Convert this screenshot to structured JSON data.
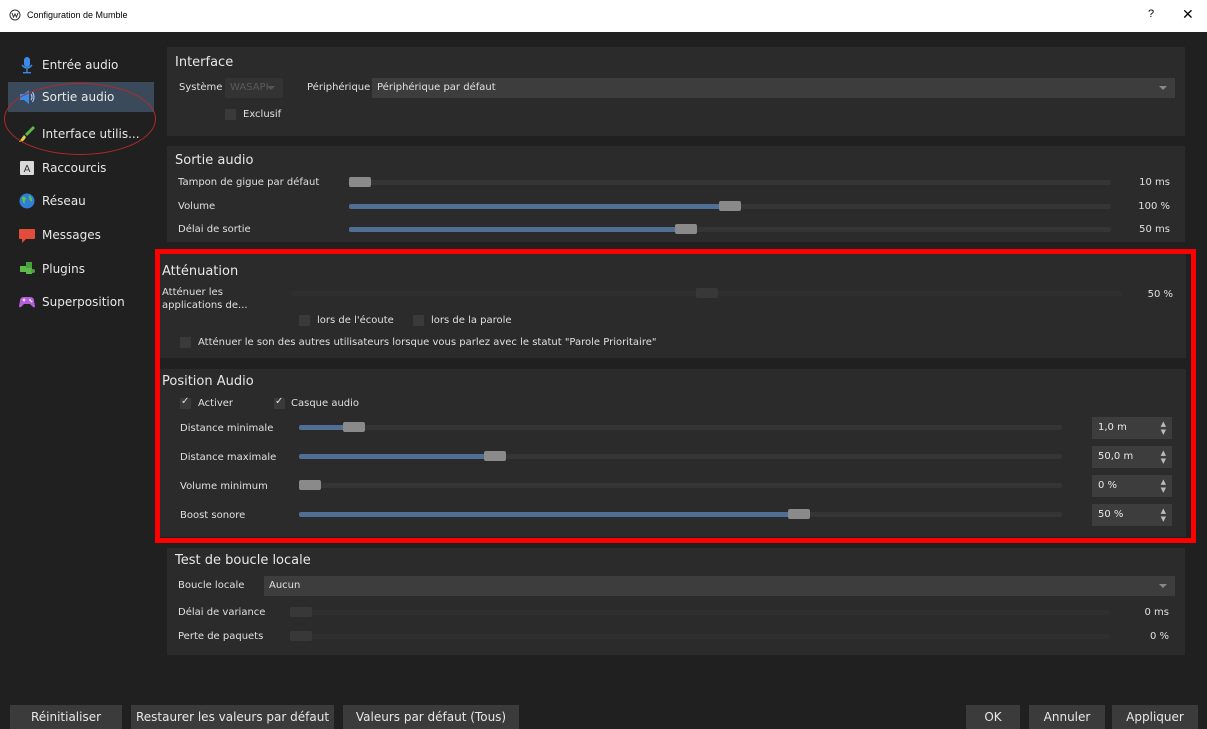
{
  "window": {
    "title": "Configuration de Mumble",
    "help": "?",
    "close": "✕"
  },
  "sidebar": {
    "items": [
      {
        "label": "Entrée audio",
        "icon": "microphone-icon"
      },
      {
        "label": "Sortie audio",
        "icon": "speaker-icon"
      },
      {
        "label": "Interface utilis...",
        "icon": "brush-icon"
      },
      {
        "label": "Raccourcis",
        "icon": "keyboard-key-icon"
      },
      {
        "label": "Réseau",
        "icon": "globe-icon"
      },
      {
        "label": "Messages",
        "icon": "chat-bubble-icon"
      },
      {
        "label": "Plugins",
        "icon": "puzzle-icon"
      },
      {
        "label": "Superposition",
        "icon": "gamepad-icon"
      }
    ],
    "active_index": 1
  },
  "interface": {
    "title": "Interface",
    "system_label": "Système",
    "system_value": "WASAPI",
    "device_label": "Périphérique",
    "device_value": "Périphérique par défaut",
    "exclusive_label": "Exclusif",
    "exclusive_checked": false
  },
  "audio_output": {
    "title": "Sortie audio",
    "jitter_label": "Tampon de gigue par défaut",
    "jitter_value": "10 ms",
    "jitter_fraction": 0.0,
    "volume_label": "Volume",
    "volume_value": "100 %",
    "volume_fraction": 0.5,
    "delay_label": "Délai de sortie",
    "delay_value": "50 ms",
    "delay_fraction": 0.44
  },
  "attenuation": {
    "title": "Atténuation",
    "apps_label_1": "Atténuer les",
    "apps_label_2": "applications de...",
    "apps_value": "50 %",
    "apps_fraction": 0.5,
    "listening_label": "lors de l'écoute",
    "speaking_label": "lors de la parole",
    "priority_label": "Atténuer le son des autres utilisateurs lorsque vous parlez avec le statut \"Parole Prioritaire\""
  },
  "positional_audio": {
    "title": "Position Audio",
    "enable_label": "Activer",
    "enable_checked": true,
    "headphones_label": "Casque audio",
    "headphones_checked": true,
    "min_distance_label": "Distance minimale",
    "min_distance_value": "1,0 m",
    "min_distance_fraction": 0.06,
    "max_distance_label": "Distance maximale",
    "max_distance_value": "50,0 m",
    "max_distance_fraction": 0.25,
    "min_volume_label": "Volume minimum",
    "min_volume_value": "0 %",
    "min_volume_fraction": 0.0,
    "loudness_label": "Boost sonore",
    "loudness_value": "50 %",
    "loudness_fraction": 0.66
  },
  "loopback": {
    "title": "Test de boucle locale",
    "loop_label": "Boucle locale",
    "loop_value": "Aucun",
    "variance_label": "Délai de variance",
    "variance_value": "0 ms",
    "packet_loss_label": "Perte de paquets",
    "packet_loss_value": "0 %"
  },
  "buttons": {
    "reset": "Réinitialiser",
    "restore_defaults": "Restaurer les valeurs par défaut",
    "defaults_all": "Valeurs par défaut (Tous)",
    "ok": "OK",
    "cancel": "Annuler",
    "apply": "Appliquer"
  },
  "colors": {
    "accent": "#4f6f94",
    "highlight": "#ff0000",
    "background": "#202020"
  }
}
